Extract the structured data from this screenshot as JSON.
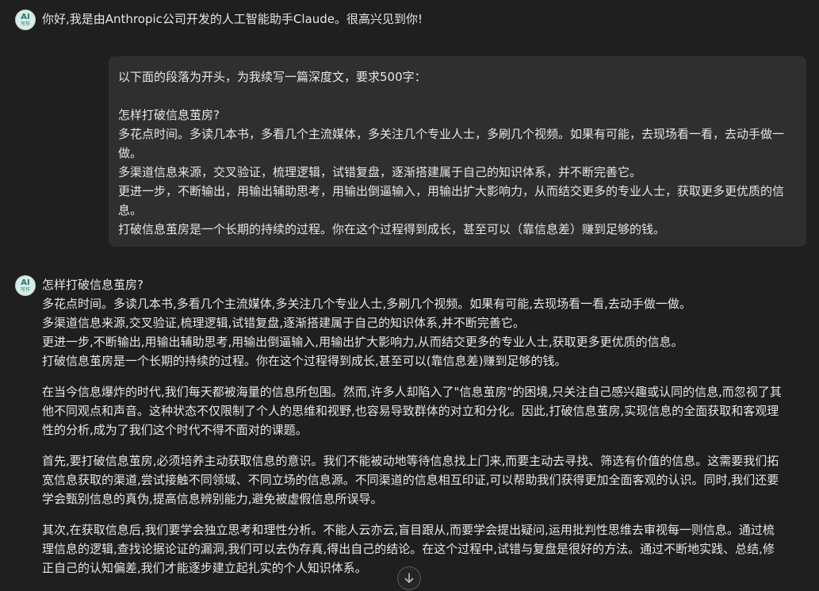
{
  "assistant": {
    "avatar_top": "AI",
    "avatar_bottom": "写作"
  },
  "greeting": "你好,我是由Anthropic公司开发的人工智能助手Claude。很高兴见到你!",
  "user_message": {
    "lines": [
      "以下面的段落为开头，为我续写一篇深度文，要求500字：",
      "",
      "怎样打破信息茧房?",
      "多花点时间。多读几本书，多看几个主流媒体，多关注几个专业人士，多刷几个视频。如果有可能，去现场看一看，去动手做一做。",
      "多渠道信息来源，交叉验证，梳理逻辑，试错复盘，逐渐搭建属于自己的知识体系，并不断完善它。",
      "更进一步，不断输出，用输出辅助思考，用输出倒逼输入，用输出扩大影响力，从而结交更多的专业人士，获取更多更优质的信息。",
      "打破信息茧房是一个长期的持续的过程。你在这个过程得到成长，甚至可以（靠信息差）赚到足够的钱。"
    ]
  },
  "reply": {
    "intro_lines": [
      "怎样打破信息茧房?",
      "多花点时间。多读几本书,多看几个主流媒体,多关注几个专业人士,多刷几个视频。如果有可能,去现场看一看,去动手做一做。",
      "多渠道信息来源,交叉验证,梳理逻辑,试错复盘,逐渐搭建属于自己的知识体系,并不断完善它。",
      "更进一步,不断输出,用输出辅助思考,用输出倒逼输入,用输出扩大影响力,从而结交更多的专业人士,获取更多更优质的信息。",
      "打破信息茧房是一个长期的持续的过程。你在这个过程得到成长,甚至可以(靠信息差)赚到足够的钱。"
    ],
    "paragraphs": [
      "在当今信息爆炸的时代,我们每天都被海量的信息所包围。然而,许多人却陷入了\"信息茧房\"的困境,只关注自己感兴趣或认同的信息,而忽视了其他不同观点和声音。这种状态不仅限制了个人的思维和视野,也容易导致群体的对立和分化。因此,打破信息茧房,实现信息的全面获取和客观理性的分析,成为了我们这个时代不得不面对的课题。",
      "首先,要打破信息茧房,必须培养主动获取信息的意识。我们不能被动地等待信息找上门来,而要主动去寻找、筛选有价值的信息。这需要我们拓宽信息获取的渠道,尝试接触不同领域、不同立场的信息源。不同渠道的信息相互印证,可以帮助我们获得更加全面客观的认识。同时,我们还要学会甄别信息的真伪,提高信息辨别能力,避免被虚假信息所误导。",
      "其次,在获取信息后,我们要学会独立思考和理性分析。不能人云亦云,盲目跟从,而要学会提出疑问,运用批判性思维去审视每一则信息。通过梳理信息的逻辑,查找论据论证的漏洞,我们可以去伪存真,得出自己的结论。在这个过程中,试错与复盘是很好的方法。通过不断地实践、总结,修正自己的认知偏差,我们才能逐步建立起扎实的个人知识体系。"
    ]
  },
  "scroll_button": {
    "icon": "arrow-down-icon"
  }
}
